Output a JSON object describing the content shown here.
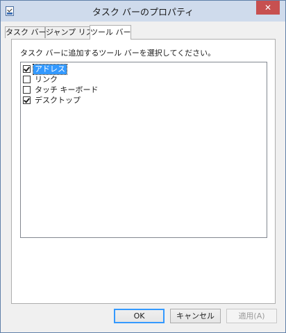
{
  "window": {
    "title": "タスク バーのプロパティ",
    "close_glyph": "✕"
  },
  "tabs": [
    {
      "label": "タスク バー",
      "active": false
    },
    {
      "label": "ジャンプ リスト",
      "active": false
    },
    {
      "label": "ツール バー",
      "active": true
    }
  ],
  "panel": {
    "instruction": "タスク バーに追加するツール バーを選択してください。",
    "toolbars": [
      {
        "label": "アドレス",
        "checked": true,
        "selected": true
      },
      {
        "label": "リンク",
        "checked": false,
        "selected": false
      },
      {
        "label": "タッチ キーボード",
        "checked": false,
        "selected": false
      },
      {
        "label": "デスクトップ",
        "checked": true,
        "selected": false
      }
    ]
  },
  "buttons": {
    "ok": "OK",
    "cancel": "キャンセル",
    "apply": "適用(A)"
  },
  "colors": {
    "titlebar": "#cfdbec",
    "close_button": "#c75050",
    "selection": "#3399ff"
  },
  "icons": {
    "app": "taskbar-properties-icon",
    "close": "close-icon",
    "check": "checkmark-icon"
  }
}
